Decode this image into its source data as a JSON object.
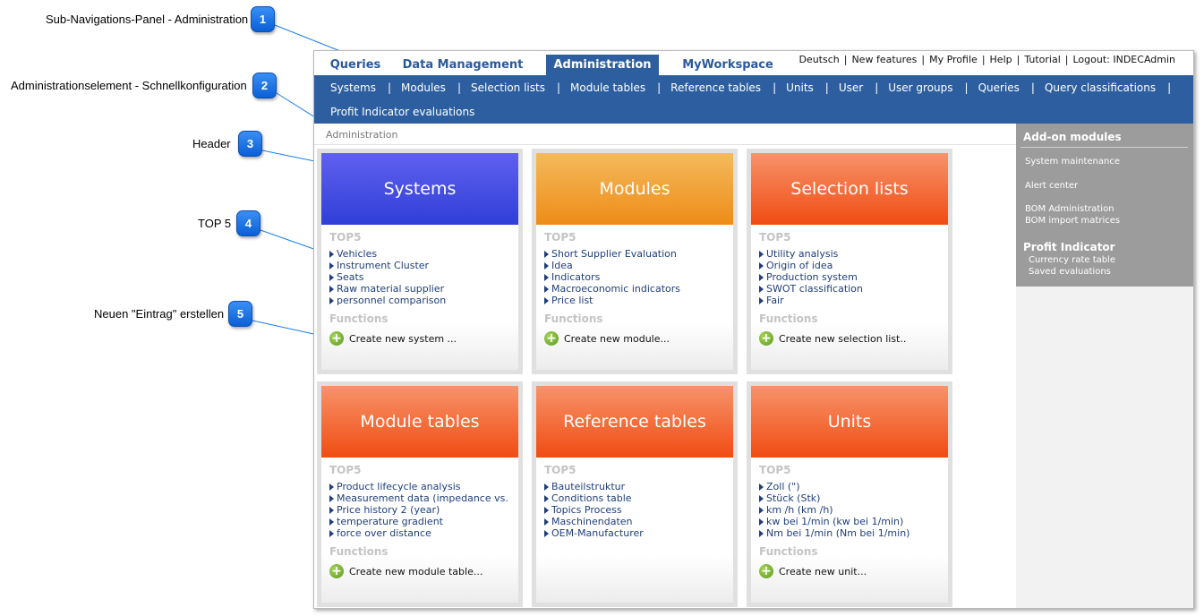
{
  "callouts": [
    {
      "number": "1",
      "label": "Sub-Navigations-Panel - Administration"
    },
    {
      "number": "2",
      "label": "Administrationselement - Schnellkonfiguration"
    },
    {
      "number": "3",
      "label": "Header"
    },
    {
      "number": "4",
      "label": "TOP 5"
    },
    {
      "number": "5",
      "label": "Neuen \"Eintrag\" erstellen"
    }
  ],
  "main_tabs": [
    {
      "label": "Queries"
    },
    {
      "label": "Data Management"
    },
    {
      "label": "Administration"
    },
    {
      "label": "MyWorkspace"
    }
  ],
  "top_links": [
    "Deutsch",
    "New features",
    "My Profile",
    "Help",
    "Tutorial",
    "Logout: INDECAdmin"
  ],
  "sub_nav": [
    "Systems",
    "Modules",
    "Selection lists",
    "Module tables",
    "Reference tables",
    "Units",
    "User",
    "User groups",
    "Queries",
    "Query classifications",
    "Profit Indicator evaluations"
  ],
  "sub_nav_separator": "|",
  "breadcrumb": "Administration",
  "cards": [
    {
      "title": "Systems",
      "top5_label": "TOP5",
      "items": [
        "Vehicles",
        "Instrument Cluster",
        "Seats",
        "Raw material supplier",
        "personnel comparison"
      ],
      "functions_label": "Functions",
      "create_label": "Create new system ..."
    },
    {
      "title": "Modules",
      "top5_label": "TOP5",
      "items": [
        "Short Supplier Evaluation",
        "Idea",
        "Indicators",
        "Macroeconomic indicators",
        "Price list"
      ],
      "functions_label": "Functions",
      "create_label": "Create new module..."
    },
    {
      "title": "Selection lists",
      "top5_label": "TOP5",
      "items": [
        "Utility analysis",
        "Origin of idea",
        "Production system",
        "SWOT classification",
        "Fair"
      ],
      "functions_label": "Functions",
      "create_label": "Create new selection list.."
    },
    {
      "title": "Module tables",
      "top5_label": "TOP5",
      "items": [
        "Product lifecycle analysis",
        "Measurement data (impedance vs.",
        "Price history 2 (year)",
        "temperature gradient",
        "force over distance"
      ],
      "functions_label": "Functions",
      "create_label": "Create new module table..."
    },
    {
      "title": "Reference tables",
      "top5_label": "TOP5",
      "items": [
        "Bauteilstruktur",
        "Conditions table",
        "Topics Process",
        "Maschinendaten",
        "OEM-Manufacturer"
      ],
      "functions_label": "",
      "create_label": ""
    },
    {
      "title": "Units",
      "top5_label": "TOP5",
      "items": [
        "Zoll (\")",
        "Stück (Stk)",
        "km /h (km /h)",
        "kw bei 1/min (kw bei 1/min)",
        "Nm bei 1/min (Nm bei 1/min)"
      ],
      "functions_label": "Functions",
      "create_label": "Create new unit..."
    }
  ],
  "side_panel": {
    "title": "Add-on modules",
    "items": [
      "System maintenance",
      "Alert center",
      "BOM Administration",
      "BOM import matrices"
    ],
    "section_title": "Profit Indicator",
    "section_items": [
      "Currency rate table",
      "Saved evaluations"
    ]
  },
  "colors": {
    "nav_blue": "#2d5fa0",
    "header_blue": "#3f4ae0",
    "header_amber": "#f0a030",
    "header_orange": "#f05a1e",
    "side_gray": "#9c9c9c",
    "badge_blue": "#1877ec"
  }
}
